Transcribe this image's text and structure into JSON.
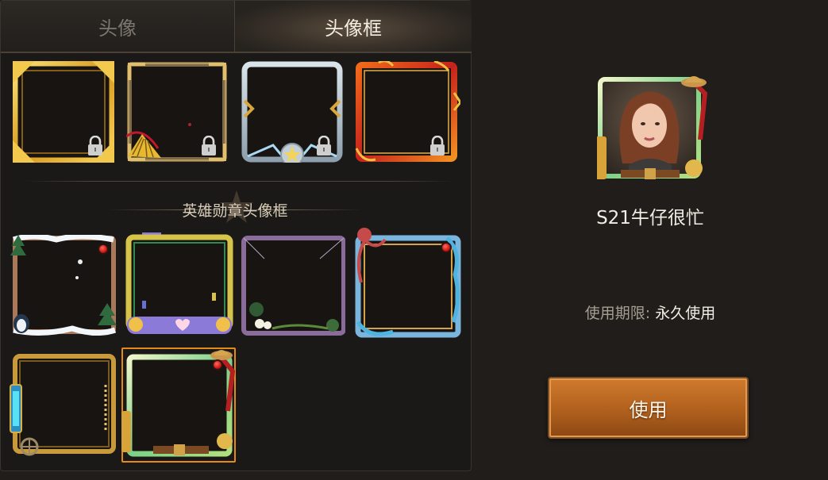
{
  "tabs": [
    {
      "label": "头像",
      "active": false
    },
    {
      "label": "头像框",
      "active": true
    }
  ],
  "section_title": "英雄勋章头像框",
  "locked_frames": [
    {
      "icon": "gold-frame-icon",
      "locked": true
    },
    {
      "icon": "fan-frame-icon",
      "locked": true
    },
    {
      "icon": "silver-star-frame-icon",
      "locked": true
    },
    {
      "icon": "fire-frame-icon",
      "locked": true
    }
  ],
  "hero_frames": [
    {
      "icon": "snow-frame-icon",
      "new": true
    },
    {
      "icon": "game-console-frame-icon",
      "new": false
    },
    {
      "icon": "spider-frame-icon",
      "new": false
    },
    {
      "icon": "octopus-frame-icon",
      "new": true
    },
    {
      "icon": "steampunk-frame-icon",
      "new": false
    },
    {
      "icon": "cowboy-frame-icon",
      "new": true,
      "selected": true
    }
  ],
  "detail": {
    "name": "S21牛仔很忙",
    "expiry_label": "使用期限:",
    "expiry_value": "永久使用",
    "use_button": "使用"
  },
  "colors": {
    "selected": "#e38b17",
    "button": "#b0601d",
    "background": "#201d1b"
  }
}
